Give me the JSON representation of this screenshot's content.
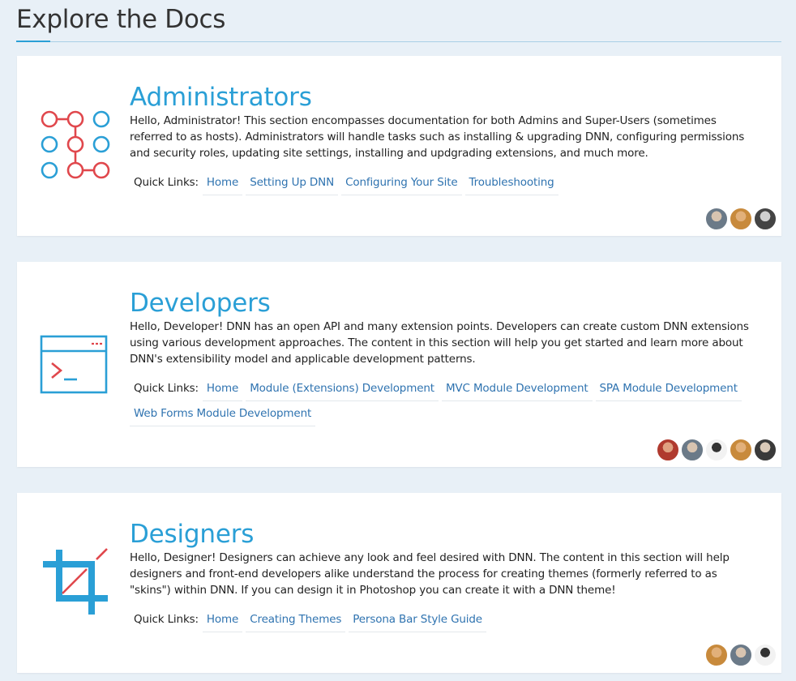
{
  "page": {
    "title": "Explore the Docs"
  },
  "cards": [
    {
      "heading": "Administrators",
      "icon": "admin-network-icon",
      "description": "Hello, Administrator! This section encompasses documentation for both Admins and Super-Users (sometimes referred to as hosts). Administrators will handle tasks such as installing & upgrading DNN, configuring permissions and security roles, updating site settings, installing and updgrading extensions, and much more.",
      "quick_links_label": "Quick Links:",
      "links": [
        "Home",
        "Setting Up DNN",
        "Configuring Your Site",
        "Troubleshooting"
      ],
      "contributors": 3
    },
    {
      "heading": "Developers",
      "icon": "terminal-window-icon",
      "description": "Hello, Developer! DNN has an open API and many extension points. Developers can create custom DNN extensions using various development approaches. The content in this section will help you get started and learn more about DNN's extensibility model and applicable development patterns.",
      "quick_links_label": "Quick Links:",
      "links": [
        "Home",
        "Module (Extensions) Development",
        "MVC Module Development",
        "SPA Module Development",
        "Web Forms Module Development"
      ],
      "contributors": 5
    },
    {
      "heading": "Designers",
      "icon": "crop-tool-icon",
      "description": "Hello, Designer! Designers can achieve any look and feel desired with DNN. The content in this section will help designers and front-end developers alike understand the process for creating themes (formerly referred to as \"skins\") within DNN. If you can design it in Photoshop you can create it with a DNN theme!",
      "quick_links_label": "Quick Links:",
      "links": [
        "Home",
        "Creating Themes",
        "Persona Bar Style Guide"
      ],
      "contributors": 3
    }
  ],
  "colors": {
    "accent": "#2a9fd6",
    "link": "#2f73b0",
    "icon_red": "#e0474c",
    "background": "#e8f0f7"
  }
}
